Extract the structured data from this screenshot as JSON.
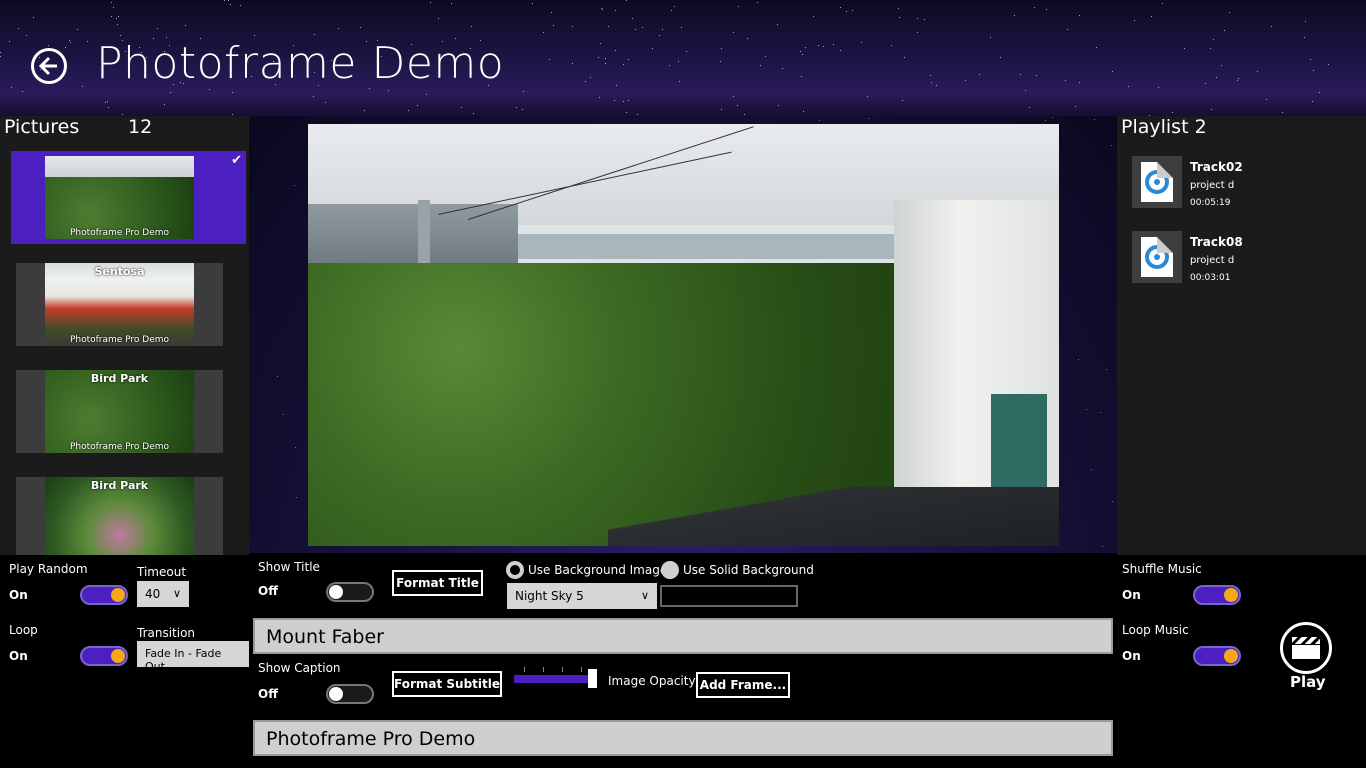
{
  "header": {
    "title": "Photoframe Demo"
  },
  "pictures": {
    "title": "Pictures",
    "count": "12",
    "items": [
      {
        "title": "",
        "subtitle": "Photoframe Pro Demo",
        "selected": true
      },
      {
        "title": "Sentosa",
        "subtitle": "Photoframe Pro Demo"
      },
      {
        "title": "Bird Park",
        "subtitle": "Photoframe Pro Demo"
      },
      {
        "title": "Bird Park",
        "subtitle": ""
      }
    ]
  },
  "playlist": {
    "title": "Playlist 2",
    "tracks": [
      {
        "name": "Track02",
        "artist": "project d",
        "duration": "00:05:19"
      },
      {
        "name": "Track08",
        "artist": "project d",
        "duration": "00:03:01"
      }
    ]
  },
  "controls": {
    "play_random": {
      "label": "Play Random",
      "value": "On"
    },
    "timeout": {
      "label": "Timeout",
      "value": "40"
    },
    "loop": {
      "label": "Loop",
      "value": "On"
    },
    "transition": {
      "label": "Transition",
      "value": "Fade In - Fade Out"
    },
    "show_title": {
      "label": "Show Title",
      "value": "Off"
    },
    "format_title": "Format Title",
    "use_bg_image": "Use Background Image",
    "use_solid_bg": "Use Solid Background",
    "background_select": "Night Sky 5",
    "title_text": "Mount Faber",
    "show_caption": {
      "label": "Show Caption",
      "value": "Off"
    },
    "format_subtitle": "Format Subtitle",
    "image_opacity": {
      "label": "Image Opacity",
      "value": 0.95
    },
    "add_frame": "Add Frame...",
    "caption_text": "Photoframe Pro Demo",
    "shuffle_music": {
      "label": "Shuffle Music",
      "value": "On"
    },
    "loop_music": {
      "label": "Loop Music",
      "value": "On"
    },
    "play": "Play"
  },
  "colors": {
    "accent": "#4b1fc0",
    "toggle_knob": "#f4a817"
  }
}
